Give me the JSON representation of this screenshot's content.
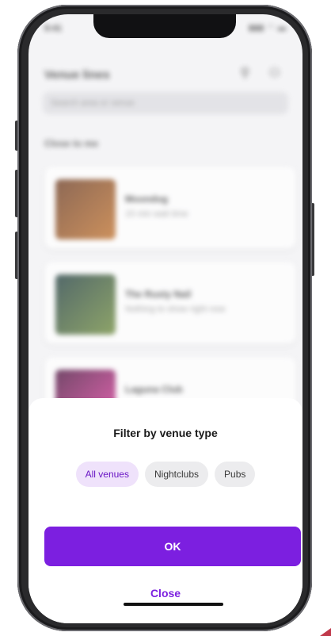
{
  "status_bar": {
    "time": "9:41",
    "icons": "▮▮▮ ◠ ▬"
  },
  "app": {
    "title": "Venue lines",
    "header_icons": "⚲ ⚇",
    "search_placeholder": "Search area or venue",
    "section_label": "Close to me",
    "venues": [
      {
        "name": "Moondog",
        "subtitle": "15 min wait time",
        "thumb_color_a": "#6b3a1f",
        "thumb_color_b": "#c0702a"
      },
      {
        "name": "The Rusty Nail",
        "subtitle": "Nothing to show right now",
        "thumb_color_a": "#1e3b3c",
        "thumb_color_b": "#6c8a3a"
      },
      {
        "name": "Laguna Club",
        "subtitle": "",
        "thumb_color_a": "#4a0f3c",
        "thumb_color_b": "#e0359a"
      }
    ]
  },
  "sheet": {
    "title": "Filter by venue type",
    "chips": [
      {
        "label": "All venues",
        "selected": true
      },
      {
        "label": "Nightclubs",
        "selected": false
      },
      {
        "label": "Pubs",
        "selected": false
      }
    ],
    "ok_label": "OK",
    "close_label": "Close"
  },
  "colors": {
    "accent": "#7c1fe0",
    "chip_selected_bg": "#efe2fb",
    "chip_selected_text": "#6a17c5",
    "chip_bg": "#ececee"
  }
}
